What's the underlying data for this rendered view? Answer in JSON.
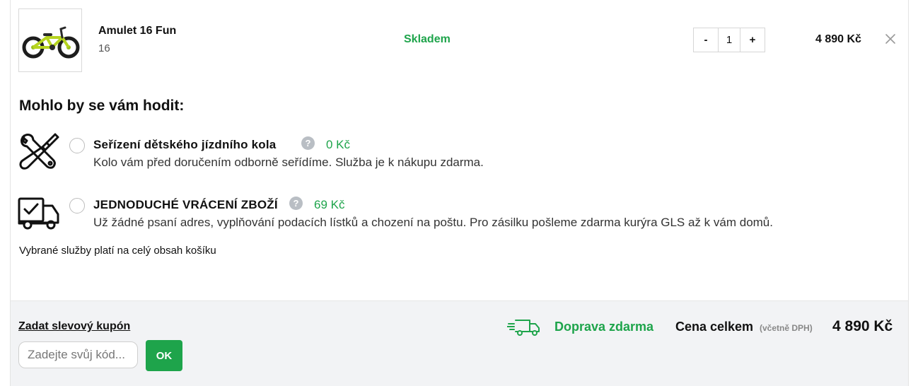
{
  "product": {
    "name": "Amulet 16 Fun",
    "variant": "16",
    "stock": "Skladem",
    "quantity": "1",
    "qty_minus": "-",
    "qty_plus": "+",
    "price": "4 890 Kč"
  },
  "upsell": {
    "title": "Mohlo by se vám hodit:",
    "services": [
      {
        "name": "Seřízení dětského jízdního kola",
        "price": "0 Kč",
        "description": "Kolo vám před doručením odborně seřídíme. Služba je k nákupu zdarma.",
        "icon": "wrench-screwdriver-icon"
      },
      {
        "name": "JEDNODUCHÉ VRÁCENÍ ZBOŽÍ",
        "price": "69 Kč",
        "description": "Už žádné psaní adres, vyplňování podacích lístků a chození na poštu. Pro zásilku pošleme zdarma kurýra GLS až k vám domů.",
        "icon": "delivery-truck-check-icon"
      }
    ],
    "help_glyph": "?",
    "note": "Vybrané služby platí na celý obsah košíku"
  },
  "footer": {
    "coupon_link": "Zadat slevový kupón",
    "coupon_placeholder": "Zadejte svůj kód...",
    "ok_label": "OK",
    "shipping": "Doprava zdarma",
    "total_label": "Cena celkem",
    "vat_note": "(včetně DPH)",
    "total_value": "4 890 Kč"
  },
  "colors": {
    "accent_green": "#1ea44b",
    "footer_bg": "#f2f3f5"
  }
}
